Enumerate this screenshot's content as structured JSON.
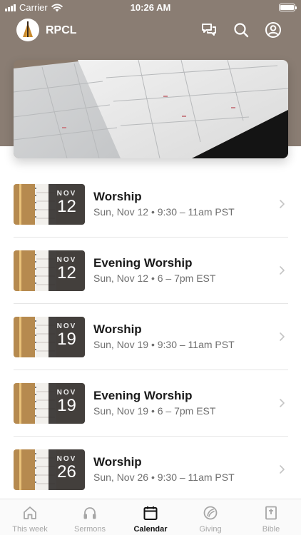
{
  "status_bar": {
    "carrier": "Carrier",
    "time": "10:26 AM"
  },
  "header": {
    "app_name": "RPCL",
    "icons": [
      "chat-icon",
      "search-icon",
      "profile-icon"
    ]
  },
  "colors": {
    "header_background": "#8a7d73",
    "active_tab": "#111111",
    "inactive_tab": "#a6a6a6",
    "badge_background": "#2b2624"
  },
  "events": [
    {
      "month": "NOV",
      "day": "12",
      "title": "Worship",
      "time": "Sun, Nov 12 • 9:30 – 11am PST"
    },
    {
      "month": "NOV",
      "day": "12",
      "title": "Evening Worship",
      "time": "Sun, Nov 12 • 6 – 7pm EST"
    },
    {
      "month": "NOV",
      "day": "19",
      "title": "Worship",
      "time": "Sun, Nov 19 • 9:30 – 11am PST"
    },
    {
      "month": "NOV",
      "day": "19",
      "title": "Evening Worship",
      "time": "Sun, Nov 19 • 6 – 7pm EST"
    },
    {
      "month": "NOV",
      "day": "26",
      "title": "Worship",
      "time": "Sun, Nov 26 • 9:30 – 11am PST"
    }
  ],
  "tabs": [
    {
      "label": "This week",
      "icon": "home-icon",
      "active": false
    },
    {
      "label": "Sermons",
      "icon": "headphones-icon",
      "active": false
    },
    {
      "label": "Calendar",
      "icon": "calendar-icon",
      "active": true
    },
    {
      "label": "Giving",
      "icon": "giving-icon",
      "active": false
    },
    {
      "label": "Bible",
      "icon": "bible-icon",
      "active": false
    }
  ]
}
